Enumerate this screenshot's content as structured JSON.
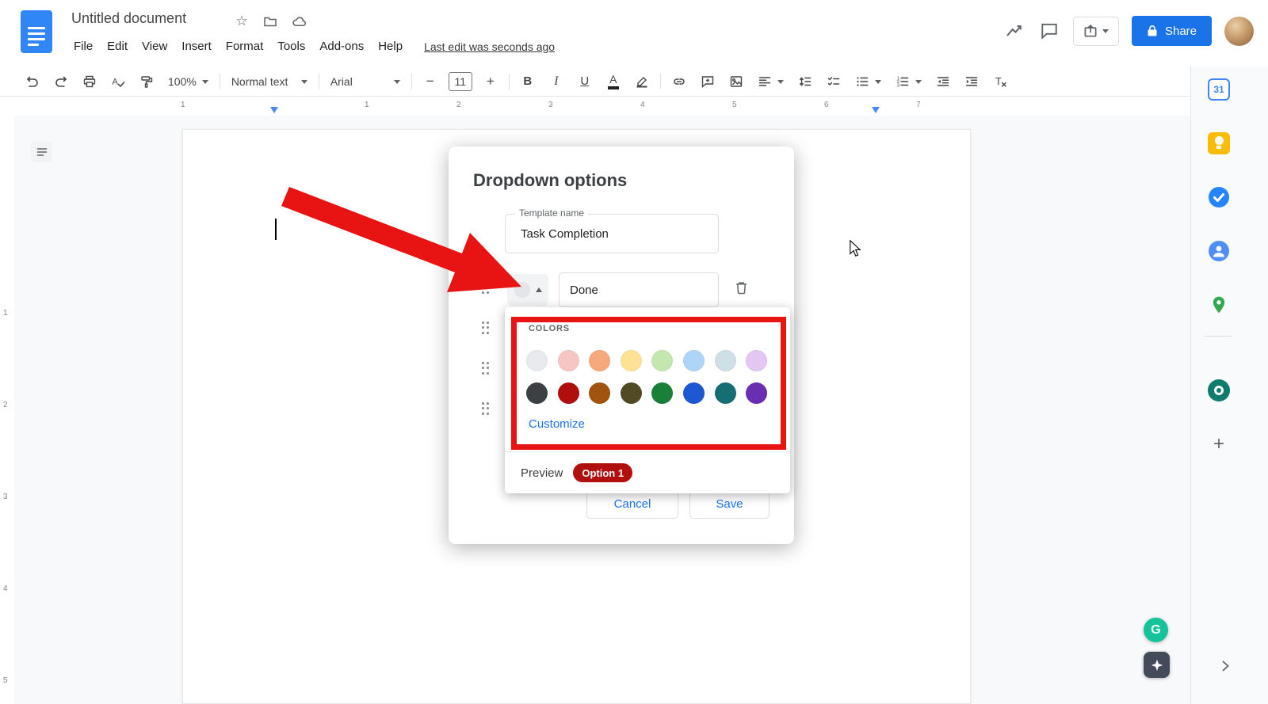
{
  "colors": {
    "accent": "#1a73e8",
    "annotation": "#e81313",
    "badge": "#b10e0e",
    "chip": "#e3e5e8"
  },
  "titlebar": {
    "doc_title": "Untitled document",
    "menus": [
      "File",
      "Edit",
      "View",
      "Insert",
      "Format",
      "Tools",
      "Add-ons",
      "Help"
    ],
    "last_edit": "Last edit was seconds ago",
    "share_label": "Share"
  },
  "toolbar": {
    "zoom": "100%",
    "style": "Normal text",
    "font": "Arial",
    "font_size": "11"
  },
  "ruler": {
    "left_label": "1",
    "labels": [
      "1",
      "2",
      "3",
      "4",
      "5",
      "6",
      "7"
    ]
  },
  "vruler": {
    "labels": [
      "1",
      "2",
      "3",
      "4",
      "5"
    ]
  },
  "side_panel": {
    "calendar_label": "31"
  },
  "widgets": {
    "grammarly_label": "G"
  },
  "dialog": {
    "title": "Dropdown options",
    "template_name_label": "Template name",
    "template_name_value": "Task Completion",
    "option_value": "Done",
    "cancel_label": "Cancel",
    "save_label": "Save",
    "color_panel": {
      "heading": "COLORS",
      "customize_label": "Customize",
      "preview_label": "Preview",
      "preview_badge": "Option 1",
      "light_colors": [
        "#e8eaed",
        "#f6c6c4",
        "#f5a97c",
        "#fde293",
        "#c4e7b0",
        "#aed5f7",
        "#cfdfe6",
        "#e3c6f1"
      ],
      "dark_colors": [
        "#3c4043",
        "#b10e0e",
        "#a0540e",
        "#514a24",
        "#188038",
        "#1b58d2",
        "#156e74",
        "#6a2eb2"
      ]
    }
  }
}
